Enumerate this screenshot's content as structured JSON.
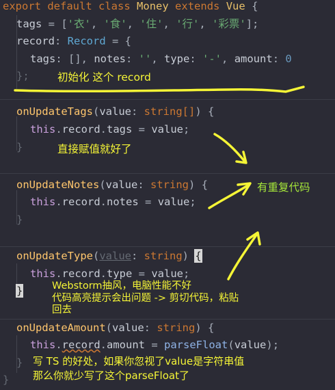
{
  "code": {
    "class_decl": {
      "kw_export": "export",
      "kw_default": "default",
      "kw_class": "class",
      "name": "Money",
      "kw_extends": "extends",
      "base": "Vue",
      "brace": "{"
    },
    "tags_line": {
      "name": "tags",
      "eq": " = [",
      "values": [
        "'衣'",
        "'食'",
        "'住'",
        "'行'",
        "'彩票'"
      ],
      "sep": ", ",
      "end": "];"
    },
    "record_line": {
      "name": "record",
      "colon": ": ",
      "type": "Record",
      "eq": " = {"
    },
    "record_body": {
      "tags_key": "tags",
      "tags_val": ": [], ",
      "notes_key": "notes",
      "notes_val": "''",
      "type_key": "type",
      "type_val": "'-'",
      "amount_key": "amount",
      "amount_val": "0",
      "comma": ", ",
      "colon": ": "
    },
    "record_end": "};",
    "methods": [
      {
        "name": "onUpdateTags",
        "param": "value",
        "type": "string[]",
        "prop": "tags"
      },
      {
        "name": "onUpdateNotes",
        "param": "value",
        "type": "string",
        "prop": "notes"
      },
      {
        "name": "onUpdateType",
        "param": "value",
        "type": "string",
        "prop": "type"
      },
      {
        "name": "onUpdateAmount",
        "param": "value",
        "type": "string",
        "prop": "amount",
        "wrap_fn": "parseFloat"
      }
    ],
    "this_kw": "this",
    "record_ref": "record",
    "close_brace": "}",
    "open_brace": "{",
    "assign": " = "
  },
  "annotations": {
    "init_record": "初始化 这个 record",
    "direct_assign": "直接赋值就好了",
    "duplicate_code": "有重复代码",
    "webstorm_lag": "Webstorm抽风，电脑性能不好\n代码高亮提示会出问题 -> 剪切代码，粘贴\n回去",
    "ts_benefit": "写 TS 的好处，如果你忽视了value是字符串值\n那么你就少写了这个parseFloat了"
  },
  "colors": {
    "background": "#2b2b35",
    "annotation_yellow": "#f5f536",
    "annotation_green": "#a5e63a"
  }
}
